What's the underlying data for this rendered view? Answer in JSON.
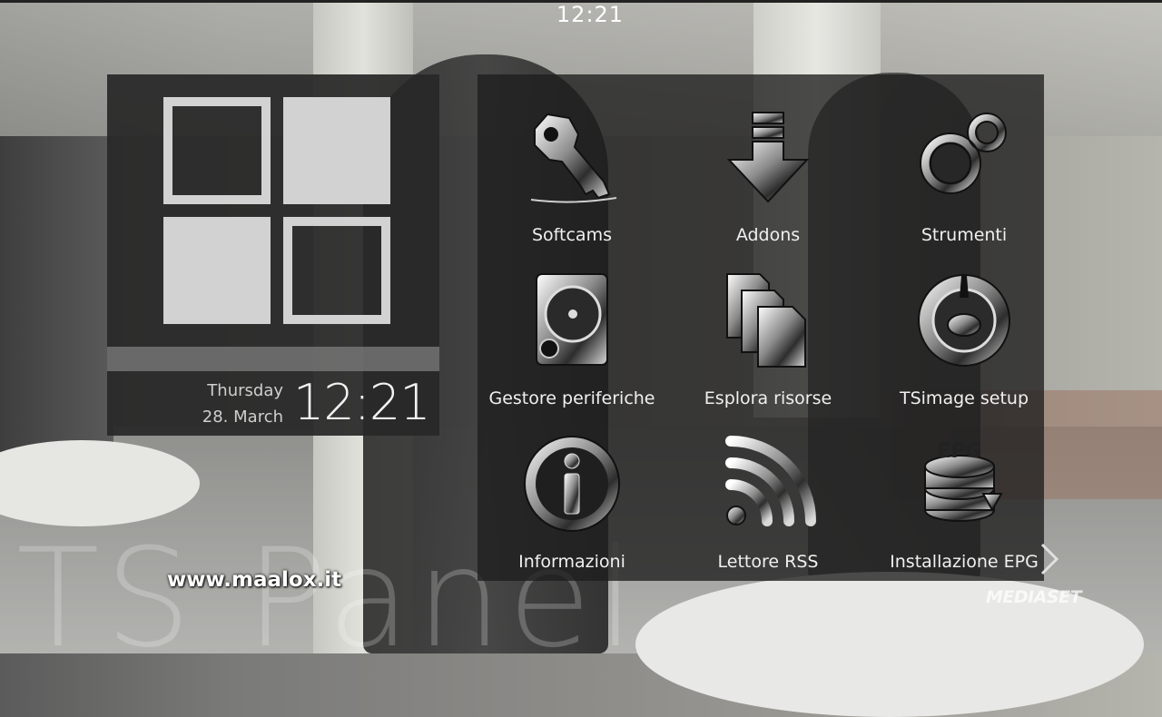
{
  "top_clock": "12:21",
  "left_panel": {
    "day": "Thursday",
    "date": "28. March",
    "time": "12:21"
  },
  "menu": {
    "items": [
      {
        "label": "Softcams",
        "icon": "key-icon"
      },
      {
        "label": "Addons",
        "icon": "download-arrow-icon"
      },
      {
        "label": "Strumenti",
        "icon": "gears-icon"
      },
      {
        "label": "Gestore periferiche",
        "icon": "hard-disk-icon"
      },
      {
        "label": "Esplora risorse",
        "icon": "files-icon"
      },
      {
        "label": "TSimage setup",
        "icon": "settings-gauge-icon"
      },
      {
        "label": "Informazioni",
        "icon": "info-icon"
      },
      {
        "label": "Lettore RSS",
        "icon": "rss-icon"
      },
      {
        "label": "Installazione EPG",
        "icon": "epg-database-icon"
      }
    ],
    "next_icon": "chevron-right-icon"
  },
  "watermark": "TS Panel",
  "website": "www.maalox.it",
  "channel_logo": "MEDIASET"
}
